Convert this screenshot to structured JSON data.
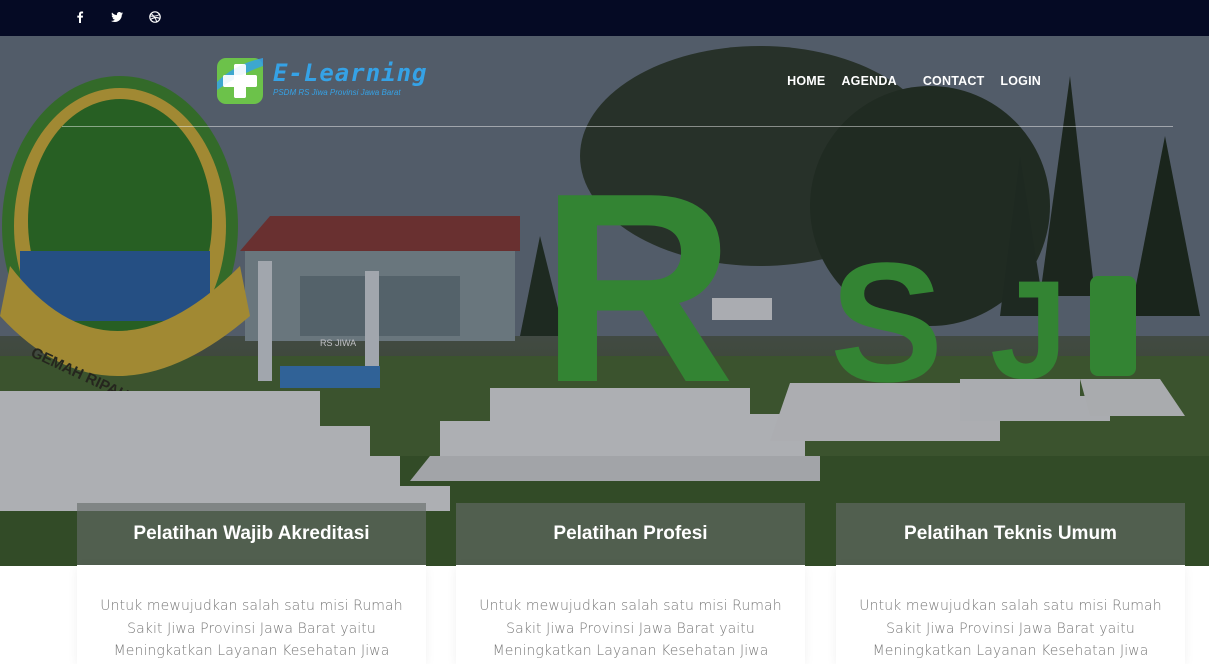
{
  "topbar": {
    "social": [
      {
        "name": "facebook-icon"
      },
      {
        "name": "twitter-icon"
      },
      {
        "name": "dribbble-icon"
      }
    ]
  },
  "logo": {
    "title": "E-Learning",
    "subtitle": "PSDM RS Jiwa Provinsi Jawa Barat",
    "colors": {
      "green": "#6cc24a",
      "blue": "#35a2e6"
    }
  },
  "nav": {
    "items": [
      "HOME",
      "AGENDA",
      "CONTACT",
      "LOGIN"
    ]
  },
  "hero": {
    "sign_letters": [
      "R",
      "S",
      "J",
      "+"
    ],
    "emblem_motto": "GEMAH RIPAH REPEH RAPIH",
    "building_sign": "RS JIWA"
  },
  "cards": [
    {
      "title": "Pelatihan Wajib Akreditasi",
      "text": "Untuk mewujudkan salah satu misi Rumah Sakit Jiwa Provinsi Jawa Barat yaitu Meningkatkan Layanan Kesehatan Jiwa"
    },
    {
      "title": "Pelatihan Profesi",
      "text": "Untuk mewujudkan salah satu misi Rumah Sakit Jiwa Provinsi Jawa Barat yaitu Meningkatkan Layanan Kesehatan Jiwa"
    },
    {
      "title": "Pelatihan Teknis Umum",
      "text": "Untuk mewujudkan salah satu misi Rumah Sakit Jiwa Provinsi Jawa Barat yaitu Meningkatkan Layanan Kesehatan Jiwa"
    }
  ],
  "colors": {
    "topbar": "#050a24",
    "sign_green": "#3fae3a",
    "card_text": "#7a7a7a"
  }
}
